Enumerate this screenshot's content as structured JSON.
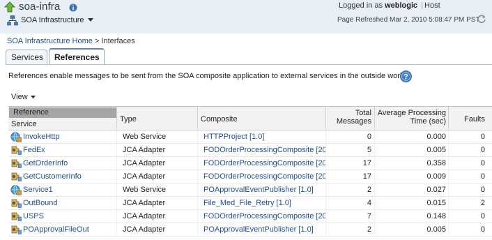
{
  "header": {
    "app_title": "soa-infra",
    "soa_menu_label": "SOA Infrastructure",
    "login_prefix": "Logged in as",
    "user": "weblogic",
    "host_separator": "|",
    "host_label": "Host",
    "page_refreshed": "Page Refreshed Mar 2, 2010 5:08:47 PM PST"
  },
  "breadcrumb": {
    "home": "SOA Infrastructure Home",
    "separator": ">",
    "current": "Interfaces"
  },
  "tabs": [
    {
      "label": "Services",
      "selected": false
    },
    {
      "label": "References",
      "selected": true
    }
  ],
  "panel": {
    "description": "References enable messages to be sent from the SOA composite application to external services in the outside world."
  },
  "toolbar": {
    "view_label": "View"
  },
  "table": {
    "group_header": "Reference",
    "columns": {
      "service": "Service",
      "type": "Type",
      "composite": "Composite",
      "total_line1": "Total",
      "total_line2": "Messages",
      "avg_line1": "Average Processing",
      "avg_line2": "Time (sec)",
      "faults": "Faults"
    },
    "rows": [
      {
        "service": "InvokeHttp",
        "icon": "web-service-icon",
        "type": "Web Service",
        "composite": "HTTPProject [1.0]",
        "total": "0",
        "avg": "0.000",
        "faults": "0"
      },
      {
        "service": "FedEx",
        "icon": "jca-adapter-icon",
        "type": "JCA Adapter",
        "composite": "FODOrderProcessingComposite [20",
        "total": "5",
        "avg": "0.005",
        "faults": "0"
      },
      {
        "service": "GetOrderInfo",
        "icon": "jca-adapter-icon",
        "type": "JCA Adapter",
        "composite": "FODOrderProcessingComposite [20",
        "total": "17",
        "avg": "0.358",
        "faults": "0"
      },
      {
        "service": "GetCustomerInfo",
        "icon": "jca-adapter-icon",
        "type": "JCA Adapter",
        "composite": "FODOrderProcessingComposite [20",
        "total": "17",
        "avg": "0.009",
        "faults": "0"
      },
      {
        "service": "Service1",
        "icon": "web-service-icon",
        "type": "Web Service",
        "composite": "POApprovalEventPublisher [1.0]",
        "total": "2",
        "avg": "0.027",
        "faults": "0"
      },
      {
        "service": "OutBound",
        "icon": "jca-adapter-icon",
        "type": "JCA Adapter",
        "composite": "File_Med_File_Retry [1.0]",
        "total": "4",
        "avg": "0.015",
        "faults": "2"
      },
      {
        "service": "USPS",
        "icon": "jca-adapter-icon",
        "type": "JCA Adapter",
        "composite": "FODOrderProcessingComposite [20",
        "total": "7",
        "avg": "0.148",
        "faults": "0"
      },
      {
        "service": "POApprovalFileOut",
        "icon": "jca-adapter-icon",
        "type": "JCA Adapter",
        "composite": "POApprovalEventPublisher [1.0]",
        "total": "2",
        "avg": "0.005",
        "faults": "0"
      }
    ]
  }
}
